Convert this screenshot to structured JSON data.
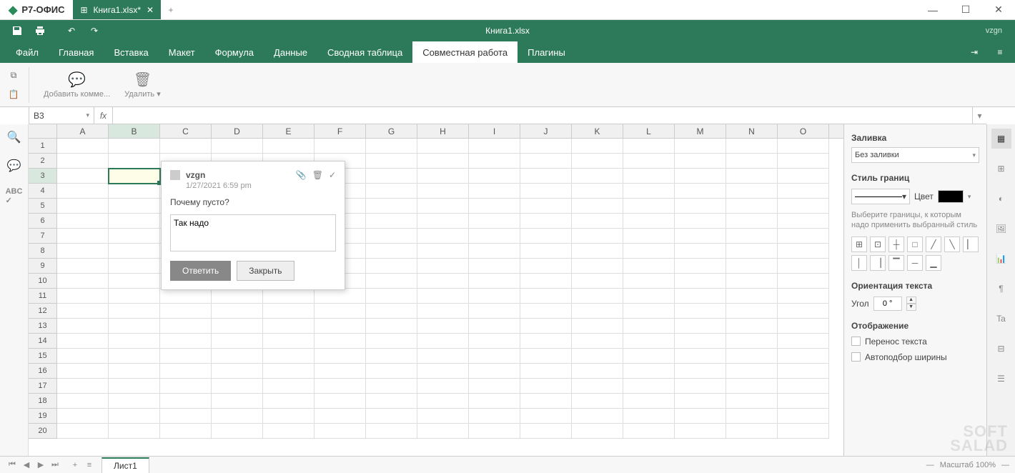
{
  "app": {
    "name": "Р7-ОФИС"
  },
  "tab": {
    "label": "Книга1.xlsx*"
  },
  "toolbar": {
    "doc_title": "Книга1.xlsx",
    "user": "vzgn"
  },
  "menu": {
    "items": [
      "Файл",
      "Главная",
      "Вставка",
      "Макет",
      "Формула",
      "Данные",
      "Сводная таблица",
      "Совместная работа",
      "Плагины"
    ],
    "active_index": 7
  },
  "ribbon": {
    "add_comment": "Добавить комме...",
    "delete": "Удалить"
  },
  "cell_ref": "B3",
  "fx": "fx",
  "columns": [
    "A",
    "B",
    "C",
    "D",
    "E",
    "F",
    "G",
    "H",
    "I",
    "J",
    "K",
    "L",
    "M",
    "N",
    "O"
  ],
  "rows": 20,
  "active": {
    "row": 3,
    "col": 1
  },
  "comment": {
    "author": "vzgn",
    "date": "1/27/2021 6:59 pm",
    "text": "Почему пусто?",
    "reply_value": "Так надо",
    "btn_reply": "Ответить",
    "btn_close": "Закрыть"
  },
  "panel": {
    "fill_label": "Заливка",
    "fill_value": "Без заливки",
    "border_style_label": "Стиль границ",
    "color_label": "Цвет",
    "hint": "Выберите границы, к которым надо применить выбранный стиль",
    "orient_label": "Ориентация текста",
    "angle_label": "Угол",
    "angle_value": "0 °",
    "display_label": "Отображение",
    "wrap": "Перенос текста",
    "shrink": "Автоподбор ширины"
  },
  "sheet": {
    "name": "Лист1"
  },
  "status": {
    "zoom": "Масштаб 100%"
  },
  "watermark": {
    "l1": "SOFT",
    "l2": "SALAD"
  }
}
